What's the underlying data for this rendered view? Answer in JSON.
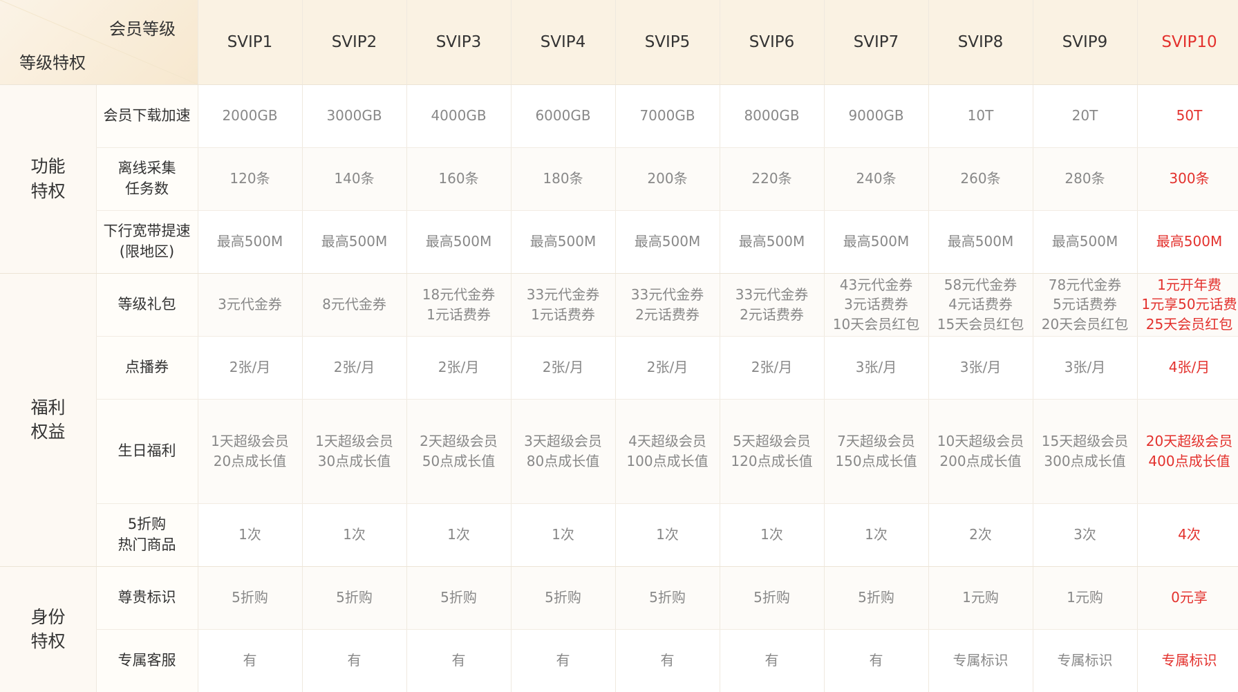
{
  "header": {
    "corner_top": "会员等级",
    "corner_bottom": "等级特权",
    "levels": [
      "SVIP1",
      "SVIP2",
      "SVIP3",
      "SVIP4",
      "SVIP5",
      "SVIP6",
      "SVIP7",
      "SVIP8",
      "SVIP9",
      "SVIP10"
    ],
    "highlight_color": "#e3312d"
  },
  "categories": [
    {
      "label": "功能\n特权"
    },
    {
      "label": "福利\n权益"
    },
    {
      "label": "身份\n特权"
    }
  ],
  "rows": [
    {
      "feature": "会员下载加速",
      "values": [
        "2000GB",
        "3000GB",
        "4000GB",
        "6000GB",
        "7000GB",
        "8000GB",
        "9000GB",
        "10T",
        "20T",
        "50T"
      ]
    },
    {
      "feature": "离线采集\n任务数",
      "values": [
        "120条",
        "140条",
        "160条",
        "180条",
        "200条",
        "220条",
        "240条",
        "260条",
        "280条",
        "300条"
      ]
    },
    {
      "feature": "下行宽带提速\n(限地区)",
      "values": [
        "最高500M",
        "最高500M",
        "最高500M",
        "最高500M",
        "最高500M",
        "最高500M",
        "最高500M",
        "最高500M",
        "最高500M",
        "最高500M"
      ]
    },
    {
      "feature": "等级礼包",
      "values": [
        "3元代金券",
        "8元代金券",
        "18元代金券\n1元话费券",
        "33元代金券\n1元话费券",
        "33元代金券\n2元话费券",
        "33元代金券\n2元话费券",
        "43元代金券\n3元话费券\n10天会员红包",
        "58元代金券\n4元话费券\n15天会员红包",
        "78元代金券\n5元话费券\n20天会员红包",
        "1元开年费\n1元享50元话费\n25天会员红包"
      ]
    },
    {
      "feature": "点播券",
      "values": [
        "2张/月",
        "2张/月",
        "2张/月",
        "2张/月",
        "2张/月",
        "2张/月",
        "3张/月",
        "3张/月",
        "3张/月",
        "4张/月"
      ]
    },
    {
      "feature": "生日福利",
      "values": [
        "1天超级会员\n20点成长值",
        "1天超级会员\n30点成长值",
        "2天超级会员\n50点成长值",
        "3天超级会员\n80点成长值",
        "4天超级会员\n100点成长值",
        "5天超级会员\n120点成长值",
        "7天超级会员\n150点成长值",
        "10天超级会员\n200点成长值",
        "15天超级会员\n300点成长值",
        "20天超级会员\n400点成长值"
      ]
    },
    {
      "feature": "5折购\n热门商品",
      "values": [
        "1次",
        "1次",
        "1次",
        "1次",
        "1次",
        "1次",
        "1次",
        "2次",
        "3次",
        "4次"
      ]
    },
    {
      "feature": "尊贵标识",
      "values": [
        "5折购",
        "5折购",
        "5折购",
        "5折购",
        "5折购",
        "5折购",
        "5折购",
        "1元购",
        "1元购",
        "0元享"
      ]
    },
    {
      "feature": "专属客服",
      "values": [
        "有",
        "有",
        "有",
        "有",
        "有",
        "有",
        "有",
        "专属标识",
        "专属标识",
        "专属标识"
      ]
    }
  ]
}
